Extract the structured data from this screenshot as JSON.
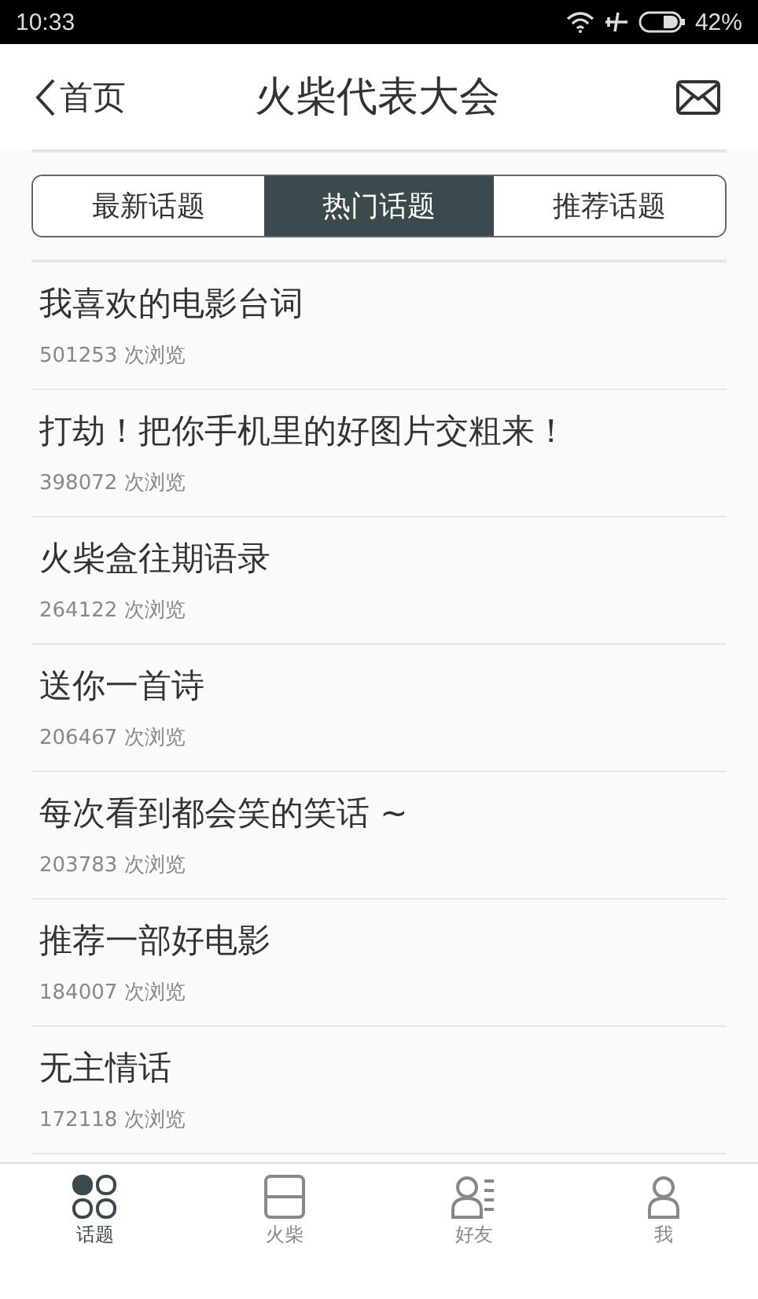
{
  "status_bar": {
    "time": "10:33",
    "battery_text": "42%"
  },
  "header": {
    "back_label": "首页",
    "title": "火柴代表大会"
  },
  "tabs": [
    {
      "label": "最新话题",
      "selected": false
    },
    {
      "label": "热门话题",
      "selected": true
    },
    {
      "label": "推荐话题",
      "selected": false
    }
  ],
  "topics": [
    {
      "title": "我喜欢的电影台词",
      "views": "501253 次浏览"
    },
    {
      "title": "打劫！把你手机里的好图片交粗来！",
      "views": "398072 次浏览"
    },
    {
      "title": "火柴盒往期语录",
      "views": "264122 次浏览"
    },
    {
      "title": "送你一首诗",
      "views": "206467 次浏览"
    },
    {
      "title": "每次看到都会笑的笑话 ~",
      "views": "203783 次浏览"
    },
    {
      "title": "推荐一部好电影",
      "views": "184007 次浏览"
    },
    {
      "title": "无主情话",
      "views": "172118 次浏览"
    }
  ],
  "bottom_nav": [
    {
      "kind": "topics",
      "label": "话题",
      "selected": true
    },
    {
      "kind": "matches",
      "label": "火柴",
      "selected": false
    },
    {
      "kind": "friends",
      "label": "好友",
      "selected": false
    },
    {
      "kind": "me",
      "label": "我",
      "selected": false
    }
  ]
}
